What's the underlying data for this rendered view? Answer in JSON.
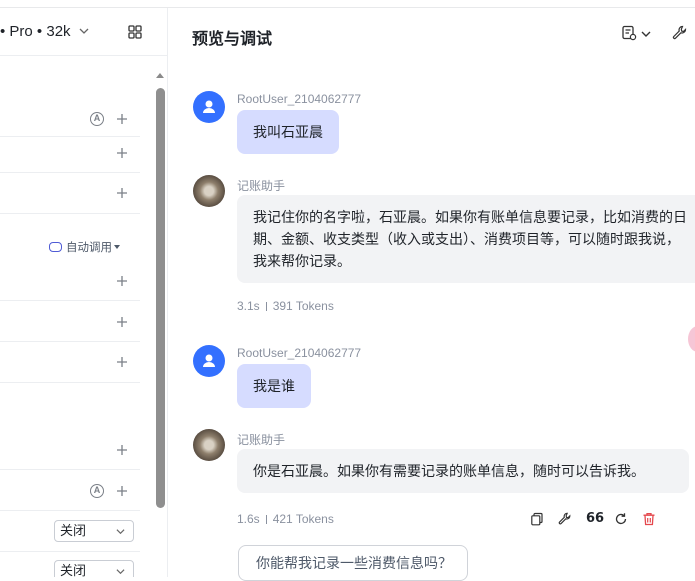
{
  "left_panel": {
    "model_label": "• Pro • 32k",
    "auto_call_label": "自动调用",
    "a_badge": "A",
    "select_1_value": "关闭",
    "select_2_value": "关闭"
  },
  "header": {
    "title": "预览与调试"
  },
  "messages": [
    {
      "role": "user",
      "name": "RootUser_2104062777",
      "text": "我叫石亚晨"
    },
    {
      "role": "bot",
      "name": "记账助手",
      "text": "我记住你的名字啦，石亚晨。如果你有账单信息要记录，比如消费的日期、金额、收支类型（收入或支出）、消费项目等，可以随时跟我说，我来帮你记录。",
      "time": "3.1s",
      "tokens": "391 Tokens"
    },
    {
      "role": "user",
      "name": "RootUser_2104062777",
      "text": "我是谁"
    },
    {
      "role": "bot",
      "name": "记账助手",
      "text": "你是石亚晨。如果你有需要记录的账单信息，随时可以告诉我。",
      "time": "1.6s",
      "tokens": "421 Tokens"
    }
  ],
  "suggestion": "你能帮我记录一些消费信息吗？",
  "quote_glyph": "66",
  "colors": {
    "accent": "#3370ff",
    "user_bubble": "#d6dcff",
    "bot_bubble": "#f2f3f5",
    "delete": "#e5484d"
  }
}
